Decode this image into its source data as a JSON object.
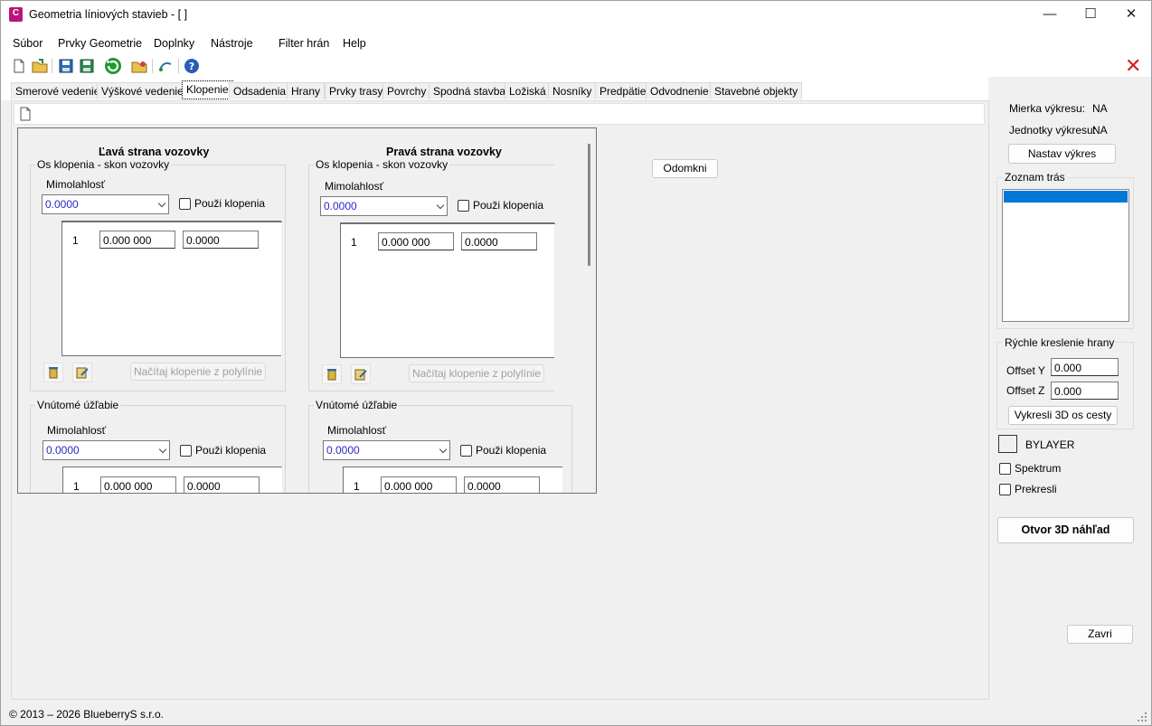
{
  "window": {
    "title": "Geometria líniových stavieb - [ ]",
    "app_icon_letter": "C",
    "minimize_glyph": "—",
    "maximize_glyph": "☐",
    "close_glyph": "✕"
  },
  "menu": [
    {
      "label": "Súbor"
    },
    {
      "label": "Prvky Geometrie"
    },
    {
      "label": "Doplnky"
    },
    {
      "label": "Nástroje"
    },
    {
      "label": "Filter hrán"
    },
    {
      "label": "Help"
    }
  ],
  "toolbar": {
    "close_x": "✕"
  },
  "tabs": [
    {
      "label": "Smerové vedenie"
    },
    {
      "label": "Výškové vedenie"
    },
    {
      "label": "Klopenie"
    },
    {
      "label": "Odsadenia"
    },
    {
      "label": "Hrany"
    },
    {
      "label": "Prvky trasy"
    },
    {
      "label": "Povrchy"
    },
    {
      "label": "Spodná stavba"
    },
    {
      "label": "Ložiská"
    },
    {
      "label": "Nosníky"
    },
    {
      "label": "Predpätie"
    },
    {
      "label": "Odvodnenie"
    },
    {
      "label": "Stavebné objekty"
    }
  ],
  "left": {
    "heading": "Ľavá strana vozovky",
    "axis_group": "Os klopenia - skon vozovky",
    "mimolahlost": "Mimolahlosť",
    "combo_value": "0.0000",
    "use_klopenia": "Použi klopenia",
    "row_index": "1",
    "row_station": "0.000 000",
    "row_value": "0.0000",
    "load_button": "Načítaj klopenie z polylínie",
    "inner_group": "Vnútomé úžľabie",
    "inner_mimolahlost": "Mimolahlosť",
    "inner_combo_value": "0.0000",
    "inner_use_klopenia": "Použi klopenia",
    "inner_row_index": "1",
    "inner_row_station": "0.000 000",
    "inner_row_value": "0.0000"
  },
  "right": {
    "heading": "Pravá strana vozovky",
    "axis_group": "Os klopenia - skon vozovky",
    "mimolahlost": "Mimolahlosť",
    "combo_value": "0.0000",
    "use_klopenia": "Použi klopenia",
    "row_index": "1",
    "row_station": "0.000 000",
    "row_value": "0.0000",
    "load_button": "Načítaj klopenie z polylínie",
    "inner_group": "Vnútomé úžľabie",
    "inner_mimolahlost": "Mimolahlosť",
    "inner_combo_value": "0.0000",
    "inner_use_klopenia": "Použi klopenia",
    "inner_row_index": "1",
    "inner_row_station": "0.000 000",
    "inner_row_value": "0.0000"
  },
  "odomkni_button": "Odomkni",
  "side": {
    "scale_label": "Mierka výkresu:",
    "scale_value": "NA",
    "units_label": "Jednotky výkresu:",
    "units_value": "NA",
    "set_drawing_button": "Nastav výkres",
    "routes_group": "Zoznam trás",
    "quick_edges_group": "Rýchle kreslenie hrany",
    "offset_y_label": "Offset Y",
    "offset_y_value": "0.000",
    "offset_z_label": "Offset Z",
    "offset_z_value": "0.000",
    "draw_3d_button": "Vykresli 3D os cesty",
    "bylayer_label": "BYLAYER",
    "spektrum_label": "Spektrum",
    "prekresli_label": "Prekresli",
    "open_3d_button": "Otvor 3D náhľad",
    "close_button": "Zavri"
  },
  "status": "© 2013 – 2026 BlueberryS s.r.o.",
  "colors": {
    "selection": "#0078d7",
    "red_close": "#d61e1e",
    "accent_icon": "#b8167a"
  }
}
